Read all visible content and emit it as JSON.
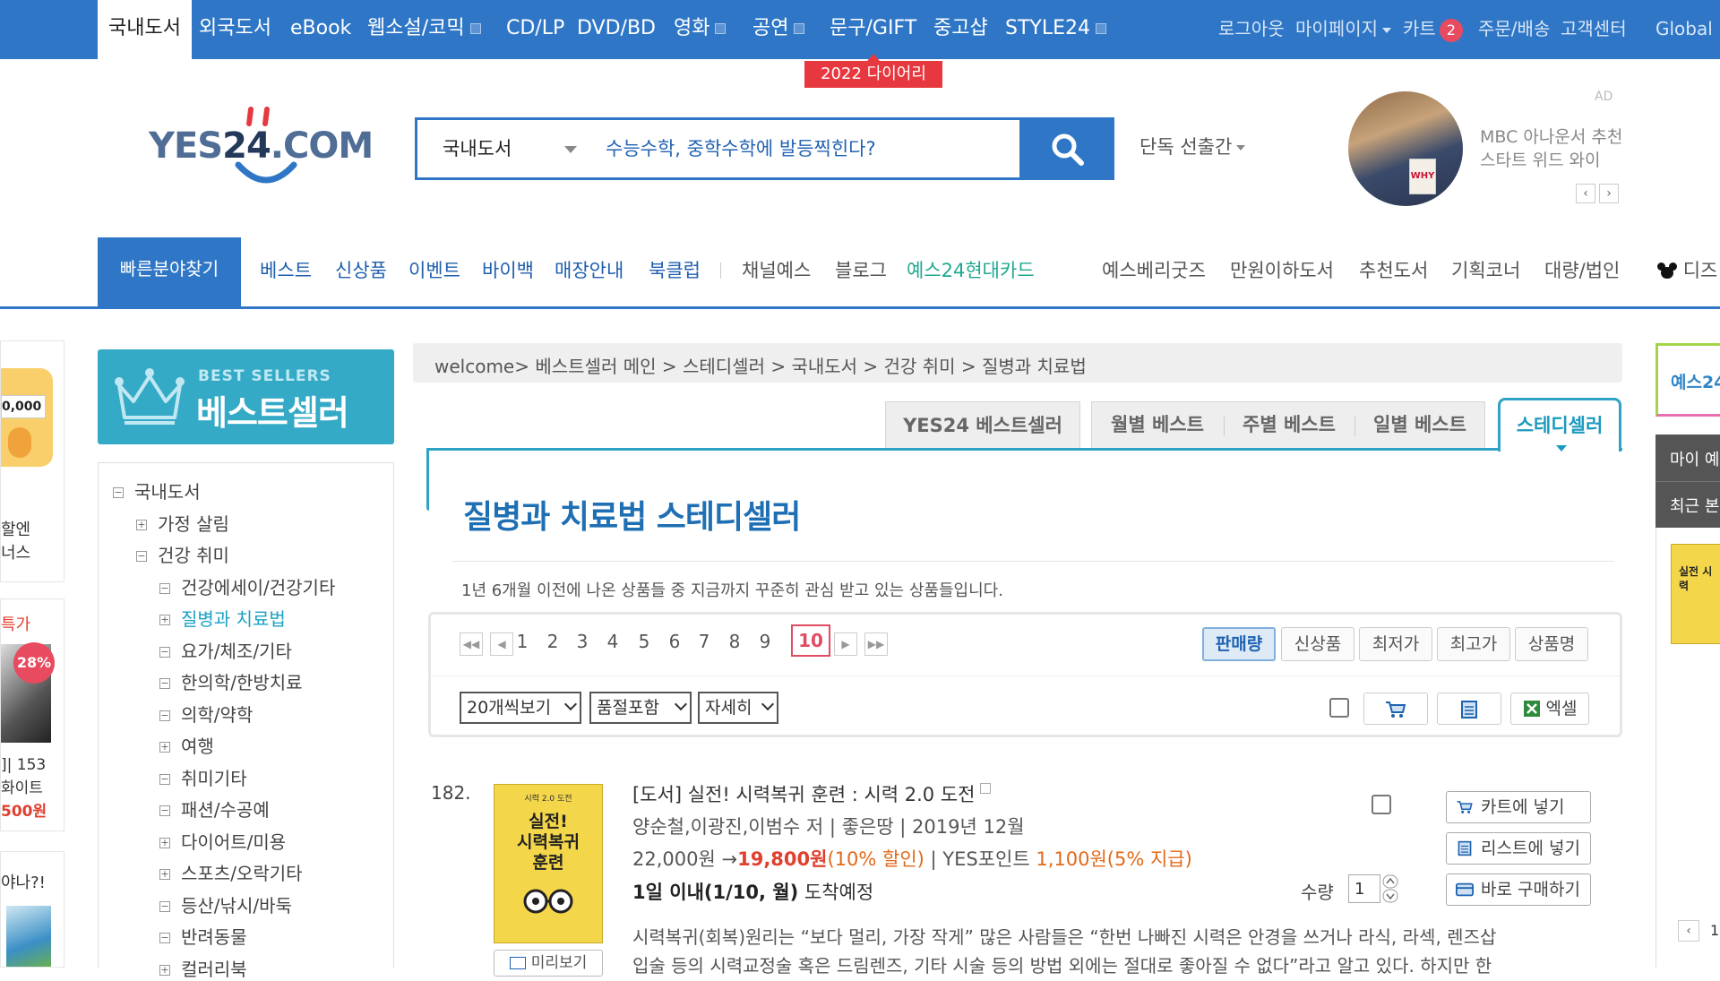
{
  "topnav": {
    "categories": [
      "국내도서",
      "외국도서",
      "eBook",
      "웹소설/코믹",
      "CD/LP",
      "DVD/BD",
      "영화",
      "공연",
      "문구/GIFT",
      "중고샵",
      "STYLE24"
    ],
    "utils": [
      "로그아웃",
      "마이페이지",
      "카트",
      "주문/배송",
      "고객센터",
      "Global"
    ],
    "cart_count": "2",
    "promo_badge": "2022 다이어리"
  },
  "header": {
    "logo": {
      "pre": "YES",
      "num": "24",
      "post": ".COM"
    },
    "search": {
      "category": "국내도서",
      "placeholder": "수능수학, 중학수학에 발등찍힌다?"
    },
    "exclusive": "단독 선출간",
    "ad": {
      "label": "AD",
      "line1": "MBC 아나운서 추천",
      "line2": "스타트 위드 와이",
      "book_mark": "WHY"
    }
  },
  "gnb": {
    "quick": "빠른분야찾기",
    "left": [
      "베스트",
      "신상품",
      "이벤트",
      "바이백",
      "매장안내",
      "북클럽"
    ],
    "mid": [
      "채널예스",
      "블로그"
    ],
    "card": "예스24현대카드",
    "right": [
      "예스베리굿즈",
      "만원이하도서",
      "추천도서",
      "기획코너",
      "대량/법인",
      "디즈"
    ]
  },
  "left_ads": {
    "ad1_price": "0,000",
    "ad1_line1": "할엔",
    "ad1_line2": "너스",
    "ad2_top": "특가",
    "ad2_discount": "28%",
    "ad2_line1": "]| 153",
    "ad2_line2": "화이트",
    "ad2_price": "500원",
    "ad3_top": "야나?!"
  },
  "bestseller": {
    "sub": "BEST SELLERS",
    "title": "베스트셀러"
  },
  "tree": [
    {
      "label": "국내도서",
      "sign": "−",
      "level": 0
    },
    {
      "label": "가정 살림",
      "sign": "+",
      "level": 1
    },
    {
      "label": "건강 취미",
      "sign": "−",
      "level": 1
    },
    {
      "label": "건강에세이/건강기타",
      "sign": "−",
      "level": 2
    },
    {
      "label": "질병과 치료법",
      "sign": "+",
      "level": 2,
      "active": true
    },
    {
      "label": "요가/체조/기타",
      "sign": "−",
      "level": 2
    },
    {
      "label": "한의학/한방치료",
      "sign": "−",
      "level": 2
    },
    {
      "label": "의학/약학",
      "sign": "−",
      "level": 2
    },
    {
      "label": "여행",
      "sign": "+",
      "level": 2
    },
    {
      "label": "취미기타",
      "sign": "−",
      "level": 2
    },
    {
      "label": "패션/수공예",
      "sign": "−",
      "level": 2
    },
    {
      "label": "다이어트/미용",
      "sign": "+",
      "level": 2
    },
    {
      "label": "스포츠/오락기타",
      "sign": "+",
      "level": 2
    },
    {
      "label": "등산/낚시/바둑",
      "sign": "−",
      "level": 2
    },
    {
      "label": "반려동물",
      "sign": "−",
      "level": 2
    },
    {
      "label": "컬러리북",
      "sign": "+",
      "level": 2
    }
  ],
  "breadcrumb": "welcome> 베스트셀러 메인 > 스테디셀러 > 국내도서 > 건강 취미 > 질병과 치료법",
  "tabs": {
    "yes24": "YES24 베스트셀러",
    "monthly": "월별 베스트",
    "weekly": "주별 베스트",
    "daily": "일별 베스트",
    "steady": "스테디셀러"
  },
  "heading": {
    "title": "질병과 치료법 스테디셀러",
    "desc": "1년 6개월 이전에 나온 상품들 중 지금까지 꾸준히 관심 받고 있는 상품들입니다."
  },
  "pager": {
    "pages": [
      "1",
      "2",
      "3",
      "4",
      "5",
      "6",
      "7",
      "8",
      "9"
    ],
    "current": "10"
  },
  "sort": [
    "판매량",
    "신상품",
    "최저가",
    "최고가",
    "상품명"
  ],
  "view_opts": {
    "per_page": "20개씩보기",
    "soldout": "품절포함",
    "detail": "자세히",
    "excel": "엑셀"
  },
  "product": {
    "rank": "182.",
    "title": "[도서] 실전! 시력복귀 훈련 : 시력 2.0 도전",
    "author_line": "양순철,이광진,이범수 저 | 좋은땅 | 2019년 12월",
    "list_price": "22,000원",
    "arrow": " →",
    "sale_price": "19,800원",
    "discount": "(10% 할인)",
    "points_label": " | YES포인트 ",
    "points": "1,100원",
    "points_rate": "(5% 지급)",
    "delivery_bold": "1일 이내(1/10, 월)",
    "delivery_rest": " 도착예정",
    "desc1": "시력복귀(회복)원리는 “보다 멀리, 가장 작게” 많은 사람들은 “한번 나빠진 시력은 안경을 쓰거나 라식, 라섹, 렌즈삽",
    "desc2": "입술 등의 시력교정술 혹은 드림렌즈, 기타 시술 등의 방법 외에는 절대로 좋아질 수 없다”라고 알고 있다. 하지만 한",
    "cover_top": "시력 2.0 도전",
    "cover_title1": "실전!",
    "cover_title2": "시력복귀",
    "cover_title3": "훈련",
    "preview": "미리보기",
    "qty_label": "수량",
    "qty": "1",
    "btn_cart": "카트에 넣기",
    "btn_list": "리스트에 넣기",
    "btn_buy": "바로 구매하기"
  },
  "right_rail": {
    "top": "예스24",
    "mid1": "마이 예",
    "mid2": "최근 본",
    "book_text": "실전 시력",
    "page": "1"
  },
  "colors": {
    "primary": "#2f77c6",
    "teal": "#2fa3c5",
    "sale": "#e0402f",
    "badge": "#e84a5f"
  }
}
